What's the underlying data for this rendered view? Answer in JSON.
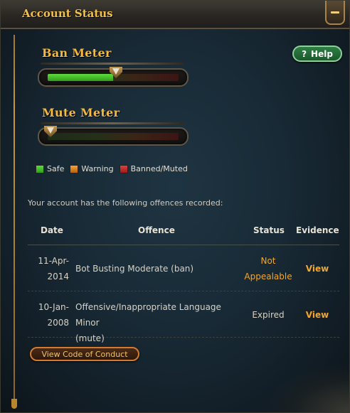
{
  "window": {
    "title": "Account Status"
  },
  "meters": {
    "ban": {
      "label": "Ban Meter",
      "level": 0.5
    },
    "mute": {
      "label": "Mute Meter",
      "level": 0.0
    }
  },
  "help_button": {
    "label": "Help",
    "icon": "question-icon"
  },
  "legend": [
    {
      "label": "Safe",
      "color": "#3cbf2a"
    },
    {
      "label": "Warning",
      "color": "#e88a1a"
    },
    {
      "label": "Banned/Muted",
      "color": "#c22a2a"
    }
  ],
  "intro_text": "Your account has the following offences recorded:",
  "table": {
    "headers": {
      "date": "Date",
      "offence": "Offence",
      "status": "Status",
      "evidence": "Evidence"
    },
    "rows": [
      {
        "date_1": "11-Apr-",
        "date_2": "2014",
        "offence_1": "Bot Busting Moderate (ban)",
        "offence_2": "",
        "status_1": "Not",
        "status_2": "Appealable",
        "evidence": "View"
      },
      {
        "date_1": "10-Jan-",
        "date_2": "2008",
        "offence_1": "Offensive/Inappropriate Language Minor",
        "offence_2": "(mute)",
        "status_1": "Expired",
        "status_2": "",
        "evidence": "View"
      }
    ]
  },
  "code_of_conduct_button": {
    "label": "View Code of Conduct"
  },
  "colors": {
    "accent": "#f4b93e",
    "link": "#f4a62a",
    "help_green": "#2f7e44"
  }
}
